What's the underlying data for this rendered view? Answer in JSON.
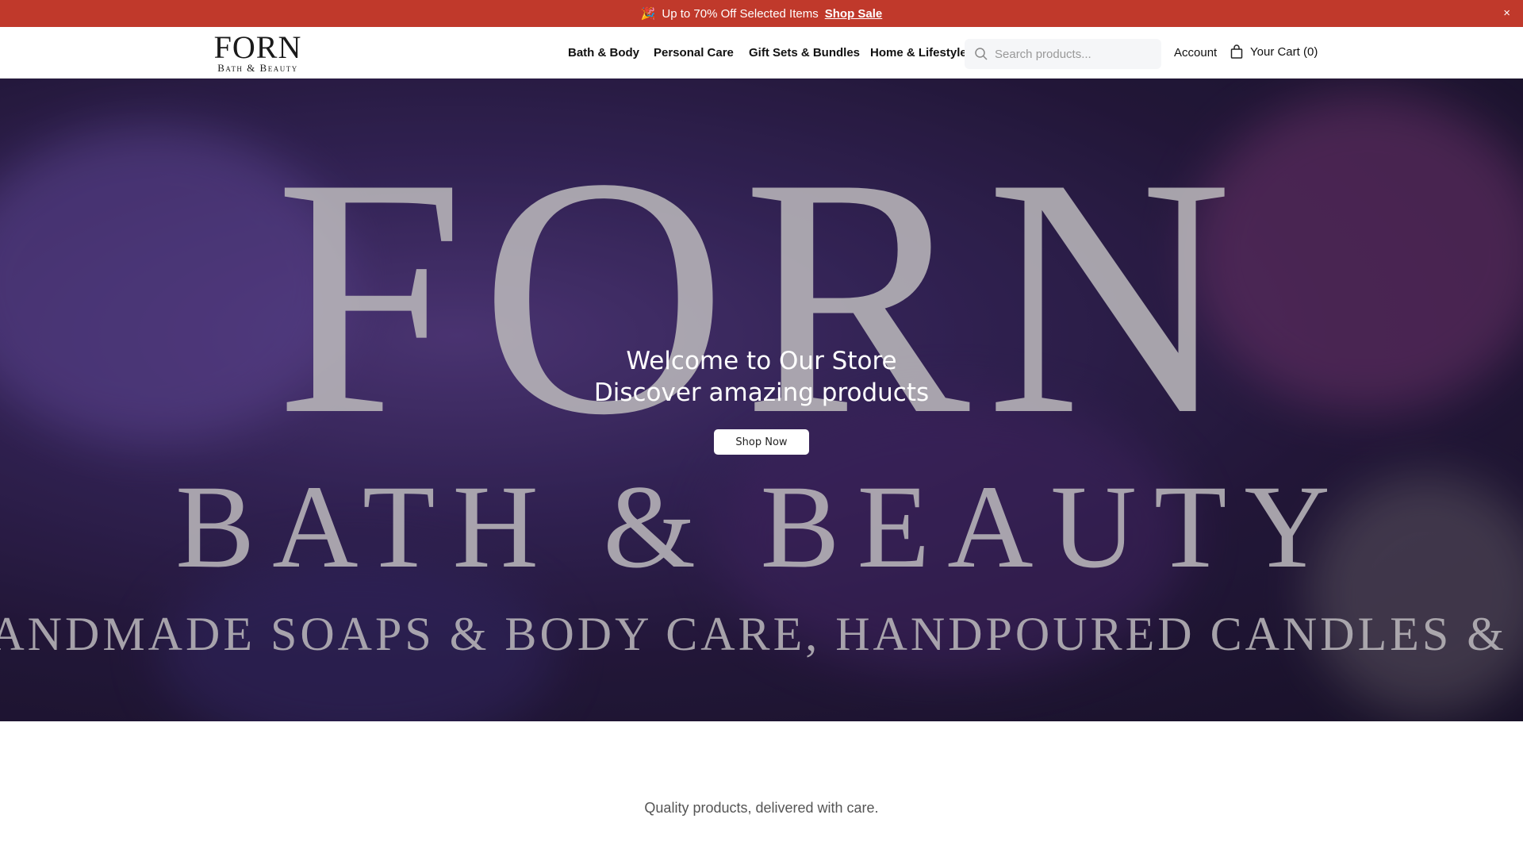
{
  "banner": {
    "icon": "party-popper-icon",
    "text": "Up to 70% Off Selected Items",
    "link": "Shop Sale",
    "close": "×"
  },
  "logo": {
    "big": "FORN",
    "small": "Bath & Beauty"
  },
  "nav": [
    "Bath & Body",
    "Personal Care",
    "Gift Sets & Bundles",
    "Home & Lifestyle"
  ],
  "search": {
    "placeholder": "Search products..."
  },
  "account": "Account",
  "cart": "Your Cart (0)",
  "hero": {
    "bg_big": "FORN",
    "bg_mid": "BATH & BEAUTY",
    "bg_small": "HANDMADE SOAPS & BODY CARE, HANDPOURED CANDLES & MORE",
    "title": "Welcome to Our Store",
    "subtitle": "Discover amazing products",
    "button": "Shop Now"
  },
  "tagline": "Quality products, delivered with care.",
  "colors": {
    "banner": "#c0392b"
  }
}
